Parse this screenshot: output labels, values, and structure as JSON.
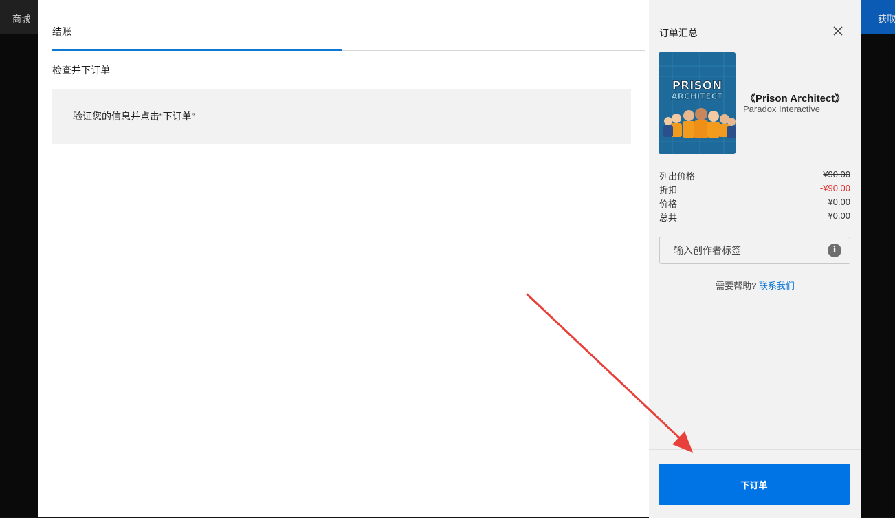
{
  "topbar": {
    "store_label": "商城",
    "get_label": "获取"
  },
  "checkout": {
    "tab_label": "结账",
    "section_title": "检查并下订单",
    "info_message": "验证您的信息并点击“下订单”"
  },
  "summary": {
    "title": "订单汇总",
    "product": {
      "title": "《Prison Architect》",
      "publisher": "Paradox Interactive",
      "cover_text_line1": "PRISON",
      "cover_text_line2": "ARCHITECT"
    },
    "prices": [
      {
        "label": "列出价格",
        "value": "¥90.00",
        "style": "strike"
      },
      {
        "label": "折扣",
        "value": "-¥90.00",
        "style": "discount"
      },
      {
        "label": "价格",
        "value": "¥0.00",
        "style": "normal"
      },
      {
        "label": "总共",
        "value": "¥0.00",
        "style": "normal"
      }
    ],
    "creator_tag_placeholder": "输入创作者标签",
    "help_text": "需要帮助?",
    "help_link": "联系我们",
    "place_order_label": "下订单"
  },
  "colors": {
    "accent": "#0074e4",
    "tab_active": "#0f78d4",
    "discount": "#d92b2b",
    "annotation_arrow": "#e8403a"
  },
  "icons": {
    "close": "close-icon",
    "info": "info-icon"
  }
}
